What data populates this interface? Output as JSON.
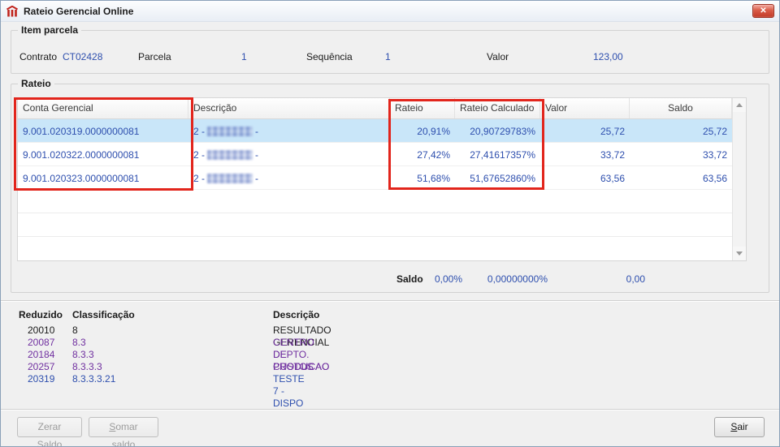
{
  "colors": {
    "value_blue": "#2e4fae",
    "label_dark": "#1a1a1a",
    "purple": "#7030a0",
    "selection_blue": "#c9e6f9",
    "annotation_red": "#e2251c",
    "disabled_text": "#9c9c9c"
  },
  "window": {
    "title": "Rateio Gerencial Online",
    "close_glyph": "✕"
  },
  "item_parcela": {
    "title": "Item parcela",
    "contrato_label": "Contrato",
    "contrato_value": "CT02428",
    "parcela_label": "Parcela",
    "parcela_value": "1",
    "sequencia_label": "Sequência",
    "sequencia_value": "1",
    "valor_label": "Valor",
    "valor_value": "123,00"
  },
  "rateio": {
    "title": "Rateio",
    "columns": {
      "conta": "Conta Gerencial",
      "descricao": "Descrição",
      "rateio": "Rateio",
      "rateio_calculado": "Rateio Calculado",
      "valor": "Valor",
      "saldo": "Saldo"
    },
    "rows": [
      {
        "conta": "9.001.020319.0000000081",
        "descricao_prefix": "2 -",
        "descricao_suffix": "-",
        "rateio": "20,91%",
        "rateio_calculado": "20,90729783%",
        "valor": "25,72",
        "saldo": "25,72"
      },
      {
        "conta": "9.001.020322.0000000081",
        "descricao_prefix": "2 -",
        "descricao_suffix": "-",
        "rateio": "27,42%",
        "rateio_calculado": "27,41617357%",
        "valor": "33,72",
        "saldo": "33,72"
      },
      {
        "conta": "9.001.020323.0000000081",
        "descricao_prefix": "2 -",
        "descricao_suffix": "-",
        "rateio": "51,68%",
        "rateio_calculado": "51,67652860%",
        "valor": "63,56",
        "saldo": "63,56"
      }
    ],
    "footer": {
      "label": "Saldo",
      "rateio": "0,00%",
      "rateio_calculado": "0,00000000%",
      "valor": "0,00"
    }
  },
  "classificacao": {
    "header_reduzido": "Reduzido",
    "header_classificacao": "Classificação",
    "header_descricao": "Descrição",
    "rows": [
      {
        "reduzido": "20010",
        "classificacao": "8",
        "descricao": "RESULTADO GERENCIAL"
      },
      {
        "reduzido": "20087",
        "classificacao": "8.3",
        "descricao": "CENTRO DE CUSTOS"
      },
      {
        "reduzido": "20184",
        "classificacao": "8.3.3",
        "descricao": "DEPTO. PRODUCAO"
      },
      {
        "reduzido": "20257",
        "classificacao": "8.3.3.3",
        "descricao": "PRODUCAO"
      },
      {
        "reduzido": "20319",
        "classificacao": "8.3.3.3.21",
        "descricao": "TESTE 7 - DISPO"
      }
    ]
  },
  "buttons": {
    "zerar_saldo": "Zerar Saldo",
    "somar_saldo": "Somar saldo",
    "sair": "Sair"
  }
}
